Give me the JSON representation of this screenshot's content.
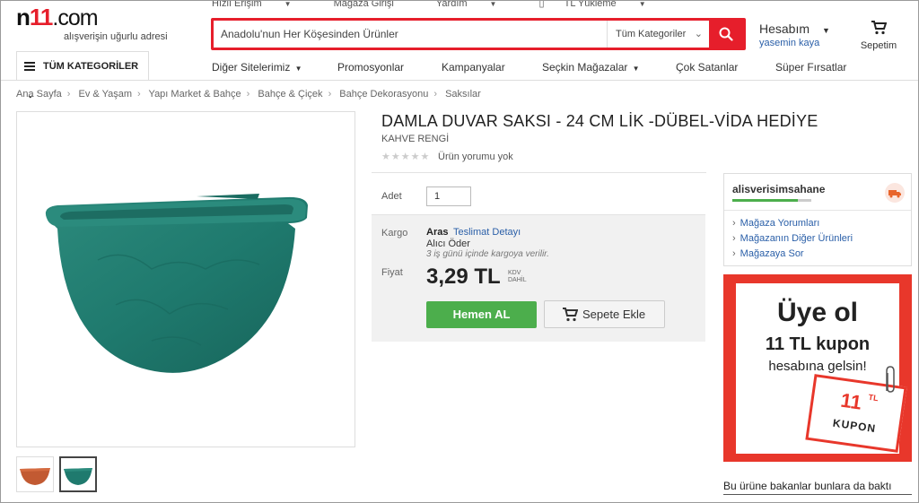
{
  "header": {
    "logo_text": "n11.com",
    "slogan": "alışverişin uğurlu adresi",
    "toplinks": [
      "Hızlı Erişim",
      "Mağaza Girişi",
      "Yardım",
      "TL Yükleme"
    ],
    "search": {
      "value": "Anadolu'nun Her Köşesinden Ürünler",
      "category": "Tüm Kategoriler"
    },
    "account": {
      "title": "Hesabım",
      "user": "yasemin kaya"
    },
    "cart_label": "Sepetim"
  },
  "nav": {
    "all_categories": "TÜM KATEGORİLER",
    "items": [
      "Diğer Sitelerimiz",
      "Promosyonlar",
      "Kampanyalar",
      "Seçkin Mağazalar",
      "Çok Satanlar",
      "Süper Fırsatlar"
    ]
  },
  "breadcrumb": [
    "Ana Sayfa",
    "Ev & Yaşam",
    "Yapı Market & Bahçe",
    "Bahçe & Çiçek",
    "Bahçe Dekorasyonu",
    "Saksılar"
  ],
  "product": {
    "title": "DAMLA DUVAR SAKSI - 24 CM LİK -DÜBEL-VİDA HEDİYE",
    "subtitle": "KAHVE RENGİ",
    "stars": "★★★★★",
    "review_text": "Ürün yorumu yok",
    "qty_label": "Adet",
    "qty_value": "1",
    "cargo_label": "Kargo",
    "cargo_name": "Aras",
    "cargo_link": "Teslimat Detayı",
    "cargo_payer": "Alıcı Öder",
    "cargo_note": "3 iş günü içinde kargoya verilir.",
    "price_label": "Fiyat",
    "price": "3,29 TL",
    "kdv_1": "KDV",
    "kdv_2": "DAHİL",
    "buy_now": "Hemen AL",
    "add_to_cart": "Sepete Ekle",
    "colors": {
      "pot_main": "#1f7a6e",
      "thumb_terracotta": "#c25a32"
    }
  },
  "seller": {
    "name": "alisverisimsahane",
    "links": [
      "Mağaza Yorumları",
      "Mağazanın Diğer Ürünleri",
      "Mağazaya Sor"
    ]
  },
  "promo": {
    "line1": "Üye ol",
    "line2": "11 TL kupon",
    "line3": "hesabına gelsin!",
    "coupon_value": "11",
    "coupon_unit": "TL",
    "coupon_text": "KUPON"
  },
  "also_viewed": "Bu ürüne bakanlar bunlara da baktı"
}
